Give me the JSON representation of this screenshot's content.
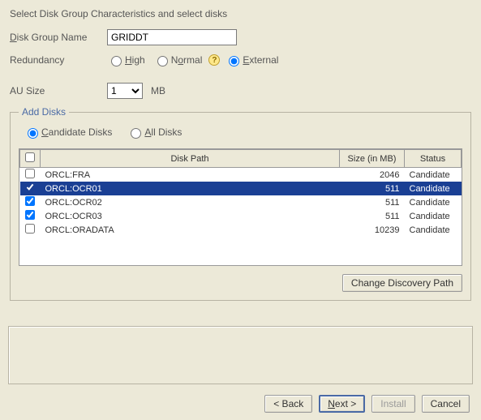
{
  "title": "Select Disk Group Characteristics and select disks",
  "fields": {
    "disk_group_name_label": "Disk Group Name",
    "disk_group_name_value": "GRIDDT",
    "redundancy_label": "Redundancy",
    "redundancy_high": "High",
    "redundancy_normal": "Normal",
    "redundancy_external": "External",
    "redundancy_selected": "External",
    "au_size_label": "AU Size",
    "au_size_value": "1",
    "au_size_unit": "MB"
  },
  "add_disks": {
    "legend": "Add Disks",
    "candidate_label": "Candidate Disks",
    "all_label": "All Disks",
    "filter_selected": "Candidate",
    "columns": {
      "path": "Disk Path",
      "size": "Size (in MB)",
      "status": "Status"
    },
    "rows": [
      {
        "checked": false,
        "selected": false,
        "path": "ORCL:FRA",
        "size": "2046",
        "status": "Candidate"
      },
      {
        "checked": true,
        "selected": true,
        "path": "ORCL:OCR01",
        "size": "511",
        "status": "Candidate"
      },
      {
        "checked": true,
        "selected": false,
        "path": "ORCL:OCR02",
        "size": "511",
        "status": "Candidate"
      },
      {
        "checked": true,
        "selected": false,
        "path": "ORCL:OCR03",
        "size": "511",
        "status": "Candidate"
      },
      {
        "checked": false,
        "selected": false,
        "path": "ORCL:ORADATA",
        "size": "10239",
        "status": "Candidate"
      }
    ],
    "change_discovery_path": "Change Discovery Path"
  },
  "nav": {
    "back": "< Back",
    "next": "Next >",
    "install": "Install",
    "cancel": "Cancel"
  }
}
